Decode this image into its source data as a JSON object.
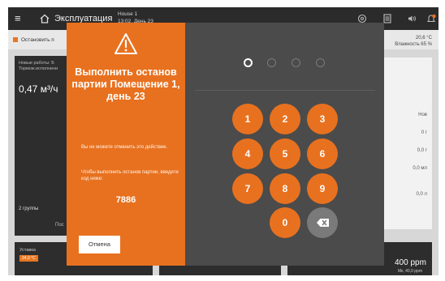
{
  "header": {
    "menu_glyph": "≡",
    "app_title": "Эксплуатация",
    "house": "House 1",
    "datetime": "13:02, День 23",
    "icons": [
      "home-icon",
      "search-icon",
      "list-icon",
      "sound-icon",
      "alarm-icon"
    ]
  },
  "background": {
    "stop_label": "Остановить п",
    "temperature": "20,6 °C",
    "humidity": "Влажность 65 %",
    "card_label": "Новые работы: Б Тормож.исполнени",
    "card_value": "0,47 м³/ч",
    "groups": "2 группы",
    "pos_label": "Пос",
    "right_values": [
      "Нов",
      "0 г",
      "0,0 г",
      "0,0 мл",
      "0,0 л"
    ],
    "ustavka": "Уставка",
    "ustavka_badge": "24,0 °C",
    "ppm": "400 ppm",
    "ppm_sub": "Мк, 40,0 ppm"
  },
  "modal": {
    "title": "Выполнить останов партии Помещение 1, день 23",
    "message1": "Вы не можете отменить это действие.",
    "message2": "Чтобы выполнить останов партии, введите код ниже:",
    "code": "7886",
    "cancel_label": "Отмена",
    "pin_length": 4,
    "pin_entered": 1,
    "keys": [
      "1",
      "2",
      "3",
      "4",
      "5",
      "6",
      "7",
      "8",
      "9",
      "0"
    ],
    "backspace_icon": "backspace-icon"
  },
  "colors": {
    "accent": "#e8711f",
    "modal_panel": "#4b4b4b",
    "header": "#2b2b2b",
    "key_backspace": "#7a7a7a"
  }
}
